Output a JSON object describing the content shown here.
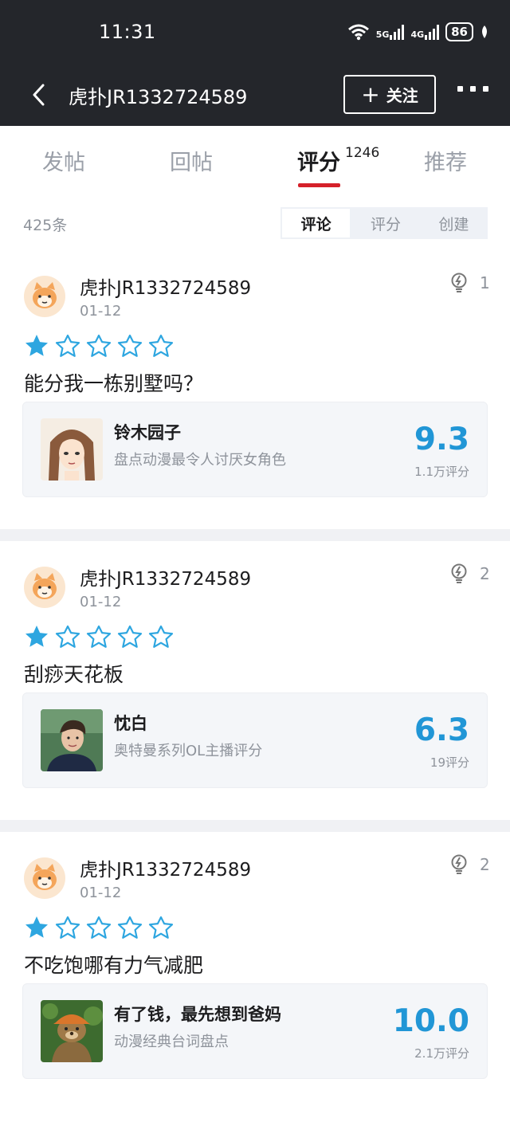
{
  "status": {
    "time": "11:31",
    "net1": "5G",
    "net2": "4G",
    "battery": "86"
  },
  "nav": {
    "title": "虎扑JR1332724589",
    "follow_label": "关注"
  },
  "tabs": [
    {
      "label": "发帖"
    },
    {
      "label": "回帖"
    },
    {
      "label": "评分",
      "badge": "1246",
      "active": true
    },
    {
      "label": "推荐"
    }
  ],
  "list": {
    "count": "425条",
    "filters": [
      "评论",
      "评分",
      "创建"
    ],
    "active_filter": "评论"
  },
  "colors": {
    "accent": "#2196d6",
    "tab_underline": "#d5202a",
    "star": "#2ea6e0"
  },
  "posts": [
    {
      "user": "虎扑JR1332724589",
      "date": "01-12",
      "likes": "1",
      "rating": 1,
      "max_rating": 5,
      "comment": "能分我一栋别墅吗？",
      "ref": {
        "title": "铃木园子",
        "subtitle": "盘点动漫最令人讨厌女角色",
        "score": "9.3",
        "votes": "1.1万评分"
      }
    },
    {
      "user": "虎扑JR1332724589",
      "date": "01-12",
      "likes": "2",
      "rating": 1,
      "max_rating": 5,
      "comment": "刮痧天花板",
      "ref": {
        "title": "忱白",
        "subtitle": "奥特曼系列OL主播评分",
        "score": "6.3",
        "votes": "19评分"
      }
    },
    {
      "user": "虎扑JR1332724589",
      "date": "01-12",
      "likes": "2",
      "rating": 1,
      "max_rating": 5,
      "comment": "不吃饱哪有力气减肥",
      "ref": {
        "title": "有了钱，最先想到爸妈",
        "subtitle": "动漫经典台词盘点",
        "score": "10.0",
        "votes": "2.1万评分"
      }
    }
  ]
}
